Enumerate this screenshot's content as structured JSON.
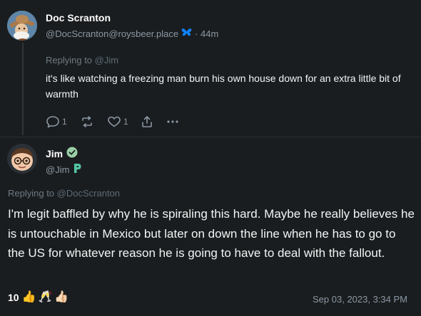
{
  "post1": {
    "author_name": "Doc Scranton",
    "author_handle": "@DocScranton@roysbeer.place",
    "time_ago": "· 44m",
    "replying_label": "Replying to",
    "replying_handle": "@Jim",
    "text": "it's like watching a freezing man burn his own house down for an extra little bit of warmth",
    "actions": {
      "reply_count": "1",
      "boost_count": "",
      "like_count": "1"
    }
  },
  "post2": {
    "author_name": "Jim",
    "author_handle": "@Jim",
    "replying_label": "Replying to",
    "replying_handle": "@DocScranton",
    "text": "I'm legit baffled by why he is spiraling this hard.  Maybe he really believes he is untouchable in Mexico but later on down the line when he has to go to the US for whatever reason he is going to have to deal with the fallout.",
    "reaction_count": "10",
    "reactions": [
      "👍",
      "🥂",
      "👍🏻"
    ],
    "timestamp": "Sep 03, 2023, 3:34 PM"
  },
  "icons": {
    "instance_badge": "butterfly-icon",
    "verified": "verified-badge-icon",
    "bot_badge": "p-badge-icon",
    "reply": "reply-icon",
    "boost": "boost-icon",
    "like": "heart-icon",
    "share": "share-icon",
    "more": "more-icon"
  },
  "colors": {
    "background": "#1a1d1f",
    "text": "#f2f4f5",
    "muted": "#8b98a5",
    "verified": "#9ad0a6",
    "butterfly": "#1185fe"
  }
}
